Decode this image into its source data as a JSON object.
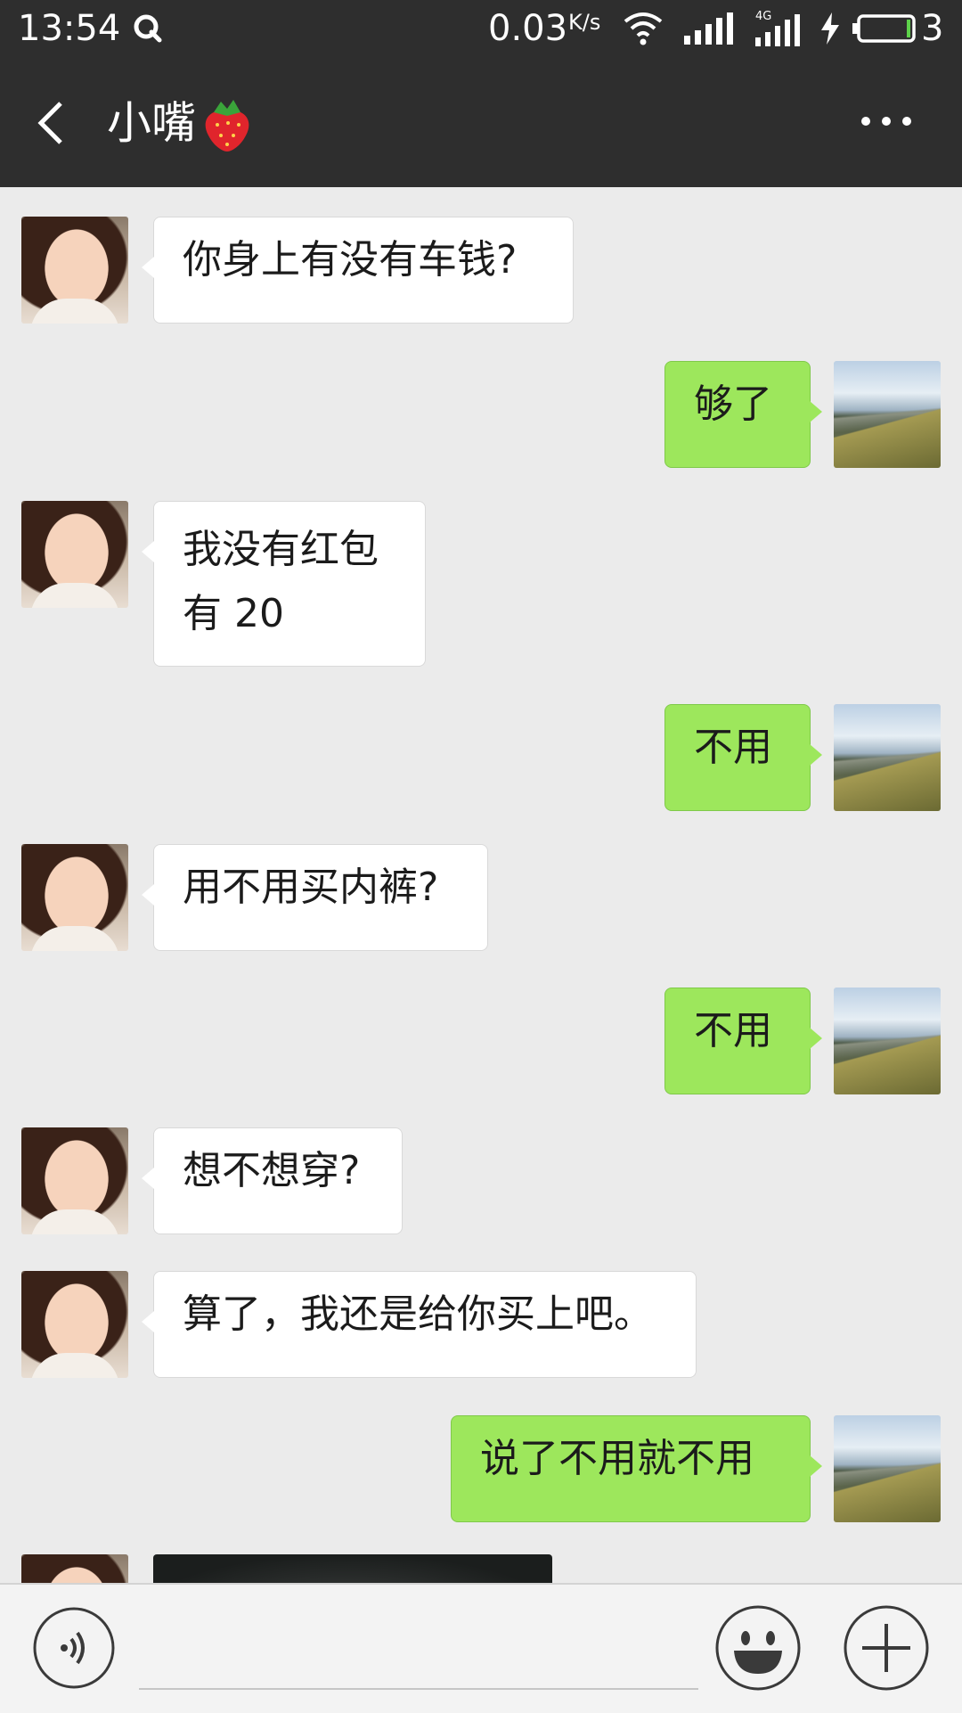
{
  "status_bar": {
    "time": "13:54",
    "net_speed": "0.03",
    "net_unit": "K/s",
    "network_type": "4G",
    "battery_level": "3"
  },
  "header": {
    "title": "小嘴",
    "title_emoji": "strawberry-emoji"
  },
  "messages": [
    {
      "side": "in",
      "text": "你身上有没有车钱?"
    },
    {
      "side": "out",
      "text": "够了"
    },
    {
      "side": "in",
      "text_line1": "我没有红包",
      "text_line2": "有 20"
    },
    {
      "side": "out",
      "text": "不用"
    },
    {
      "side": "in",
      "text": "用不用买内裤?"
    },
    {
      "side": "out",
      "text": "不用"
    },
    {
      "side": "in",
      "text": "想不想穿?"
    },
    {
      "side": "in",
      "text": "算了，我还是给你买上吧。"
    },
    {
      "side": "out",
      "text": "说了不用就不用"
    },
    {
      "side": "in",
      "type": "image"
    }
  ],
  "input_bar": {
    "placeholder": ""
  },
  "colors": {
    "bar": "#2e2e2e",
    "chat_bg": "#ebebeb",
    "out_bubble": "#9de75c",
    "in_bubble": "#ffffff"
  }
}
